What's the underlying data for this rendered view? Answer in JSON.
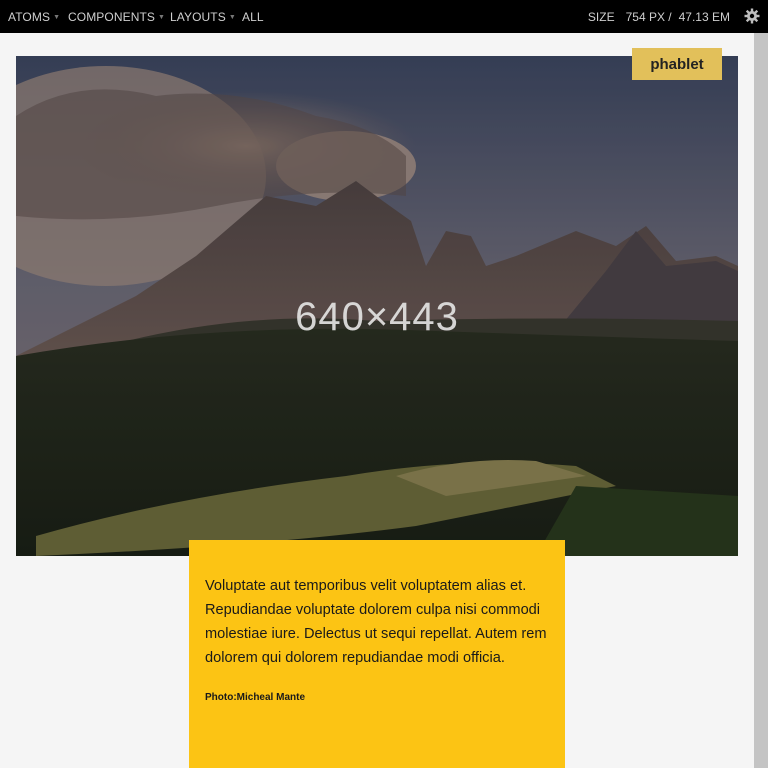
{
  "nav": {
    "items": [
      {
        "label": "ATOMS",
        "has_caret": true
      },
      {
        "label": "COMPONENTS",
        "has_caret": true
      },
      {
        "label": "LAYOUTS",
        "has_caret": true
      },
      {
        "label": "ALL",
        "has_caret": false
      }
    ],
    "size_label": "SIZE",
    "size_px": "754 PX /",
    "size_em": "47.13 EM",
    "settings_icon": "gear-icon"
  },
  "badge": {
    "label": "phablet"
  },
  "hero": {
    "dimensions": "640×443"
  },
  "caption": {
    "text": "Voluptate aut temporibus velit voluptatem alias et. Repudiandae voluptate dolorem culpa nisi commodi molestiae iure. Delectus ut sequi repellat. Autem rem dolorem qui dolorem repudiandae modi officia.",
    "credit": "Photo:Micheal Mante"
  },
  "colors": {
    "accent": "#fcc414",
    "badge": "#e2c05a",
    "topbar": "#000000"
  }
}
